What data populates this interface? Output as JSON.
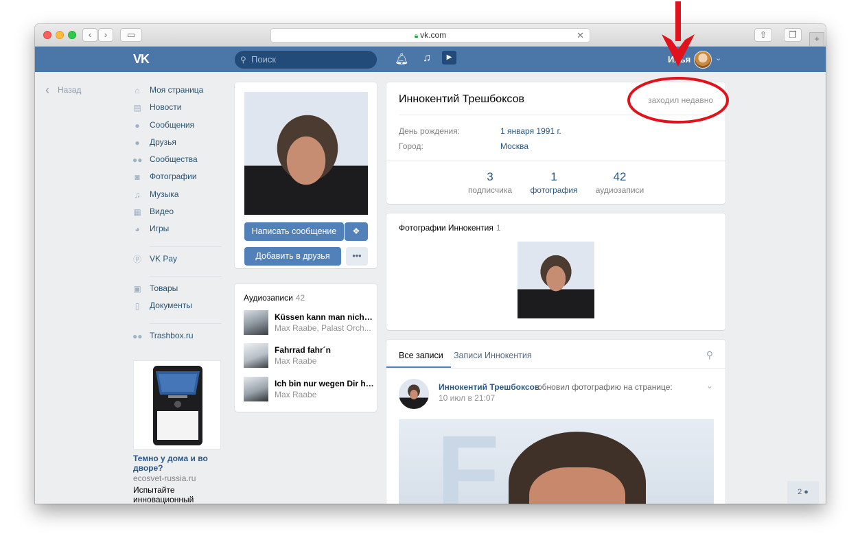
{
  "browser": {
    "url": "vk.com"
  },
  "header": {
    "logo": "VK",
    "search_placeholder": "Поиск",
    "username": "Илья"
  },
  "nav": {
    "back": "Назад",
    "items": [
      {
        "label": "Моя страница",
        "icon": "home-icon"
      },
      {
        "label": "Новости",
        "icon": "news-icon"
      },
      {
        "label": "Сообщения",
        "icon": "messages-icon"
      },
      {
        "label": "Друзья",
        "icon": "friends-icon"
      },
      {
        "label": "Сообщества",
        "icon": "groups-icon"
      },
      {
        "label": "Фотографии",
        "icon": "camera-icon"
      },
      {
        "label": "Музыка",
        "icon": "music-icon"
      },
      {
        "label": "Видео",
        "icon": "video-icon"
      },
      {
        "label": "Игры",
        "icon": "gamepad-icon"
      }
    ],
    "vkpay": "VK Pay",
    "goods": "Товары",
    "documents": "Документы",
    "trashbox": "Trashbox.ru"
  },
  "ad": {
    "title": "Темно у дома и во дворе?",
    "domain": "ecosvet-russia.ru",
    "text": "Испытайте инновационный"
  },
  "profile": {
    "write_message": "Написать сообщение",
    "add_friend": "Добавить в друзья",
    "more": "•••"
  },
  "audios": {
    "title": "Аудиозаписи",
    "count": "42",
    "items": [
      {
        "title": "Küssen kann man nicht ...",
        "artist": "Max Raabe, Palast Orch..."
      },
      {
        "title": "Fahrrad fahr´n",
        "artist": "Max Raabe"
      },
      {
        "title": "Ich bin nur wegen Dir hier",
        "artist": "Max Raabe"
      }
    ]
  },
  "info": {
    "name": "Иннокентий Трешбоксов",
    "online": "заходил недавно",
    "birthday_label": "День рождения:",
    "birthday_value": "1 января 1991 г.",
    "city_label": "Город:",
    "city_value": "Москва",
    "counters": [
      {
        "num": "3",
        "label": "подписчика"
      },
      {
        "num": "1",
        "label": "фотография"
      },
      {
        "num": "42",
        "label": "аудиозаписи"
      }
    ]
  },
  "photos": {
    "title": "Фотографии Иннокентия",
    "count": "1"
  },
  "wall": {
    "tab_all": "Все записи",
    "tab_own": "Записи Иннокентия",
    "post": {
      "author": "Иннокентий Трешбоксов",
      "action": "обновил фотографию на странице:",
      "time": "10 июл в 21:07"
    }
  },
  "friends_online": "2",
  "colors": {
    "header": "#4a76a8",
    "button": "#5181b8",
    "link": "#2a5885",
    "annotation": "#e0121b"
  }
}
